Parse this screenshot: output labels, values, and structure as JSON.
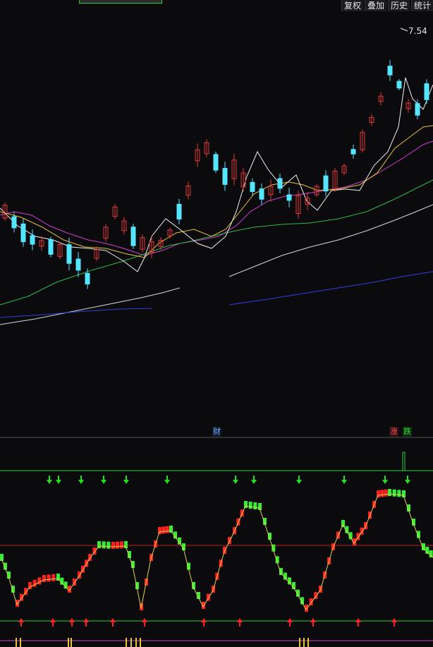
{
  "toolbar": {
    "buttons": [
      "复权",
      "叠加",
      "历史",
      "统计"
    ]
  },
  "price_panel": {
    "high_label": "7.54"
  },
  "events": {
    "finance_badge": "财",
    "limit_up_badge": "涨",
    "limit_down_badge": "跌"
  },
  "colors": {
    "background": "#0b0b0e",
    "up_candle": "#e03a3a",
    "down_candle": "#55e6ff",
    "ma_white": "#f0f0f0",
    "ma_yellow": "#e8c23a",
    "ma_magenta": "#d040d0",
    "ma_green": "#2fb84a",
    "ma_gray": "#d8d8d8",
    "ma_blue": "#3340e0",
    "osc_up": "#ff2020",
    "osc_down": "#33ee33",
    "signal_down_arrow": "#22dd22",
    "signal_up_arrow": "#ff2020"
  }
}
